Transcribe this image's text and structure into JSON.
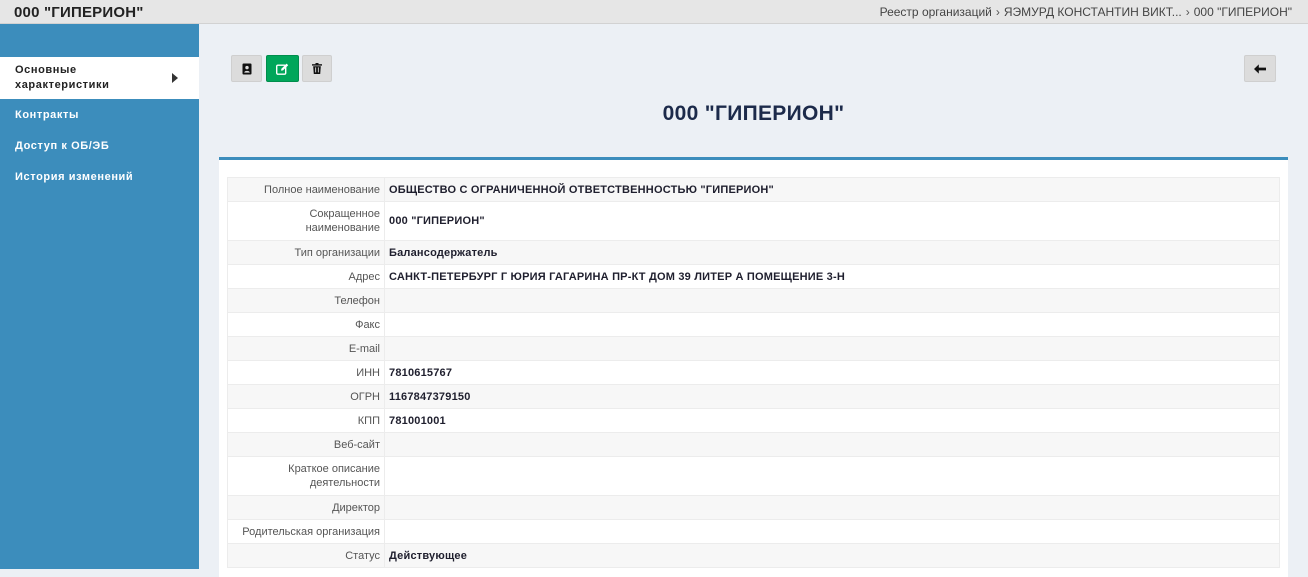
{
  "header": {
    "title": "000 \"ГИПЕРИОН\"",
    "breadcrumbs": [
      "Реестр организаций",
      "ЯЭМУРД КОНСТАНТИН ВИКТ...",
      "000 \"ГИПЕРИОН\""
    ],
    "separator": "›"
  },
  "sidebar": {
    "items": [
      {
        "label": "Основные характеристики",
        "active": true
      },
      {
        "label": "Контракты"
      },
      {
        "label": "Доступ к ОБ/ЭБ"
      },
      {
        "label": "История изменений"
      }
    ]
  },
  "toolbar": {
    "buttons": [
      {
        "icon": "contact-card-icon"
      },
      {
        "icon": "edit-icon"
      },
      {
        "icon": "trash-icon"
      }
    ],
    "back_icon": "arrow-left-icon"
  },
  "main": {
    "title": "000 \"ГИПЕРИОН\"",
    "fields": [
      {
        "label": "Полное наименование",
        "value": "ОБЩЕСТВО С ОГРАНИЧЕННОЙ ОТВЕТСТВЕННОСТЬЮ \"ГИПЕРИОН\""
      },
      {
        "label": "Сокращенное наименование",
        "value": "000 \"ГИПЕРИОН\""
      },
      {
        "label": "Тип организации",
        "value": "Балансодержатель"
      },
      {
        "label": "Адрес",
        "value": "САНКТ-ПЕТЕРБУРГ Г ЮРИЯ ГАГАРИНА ПР-КТ ДОМ 39 ЛИТЕР А ПОМЕЩЕНИЕ 3-Н"
      },
      {
        "label": "Телефон",
        "value": ""
      },
      {
        "label": "Факс",
        "value": ""
      },
      {
        "label": "E-mail",
        "value": ""
      },
      {
        "label": "ИНН",
        "value": "7810615767"
      },
      {
        "label": "ОГРН",
        "value": "1167847379150"
      },
      {
        "label": "КПП",
        "value": "781001001"
      },
      {
        "label": "Веб-сайт",
        "value": ""
      },
      {
        "label": "Краткое описание деятельности",
        "value": ""
      },
      {
        "label": "Директор",
        "value": ""
      },
      {
        "label": "Родительская организация",
        "value": ""
      },
      {
        "label": "Статус",
        "value": "Действующее"
      }
    ]
  },
  "colors": {
    "sidebar": "#3c8dbc",
    "edit_button": "#00a65a",
    "title": "#1c2a4a"
  }
}
